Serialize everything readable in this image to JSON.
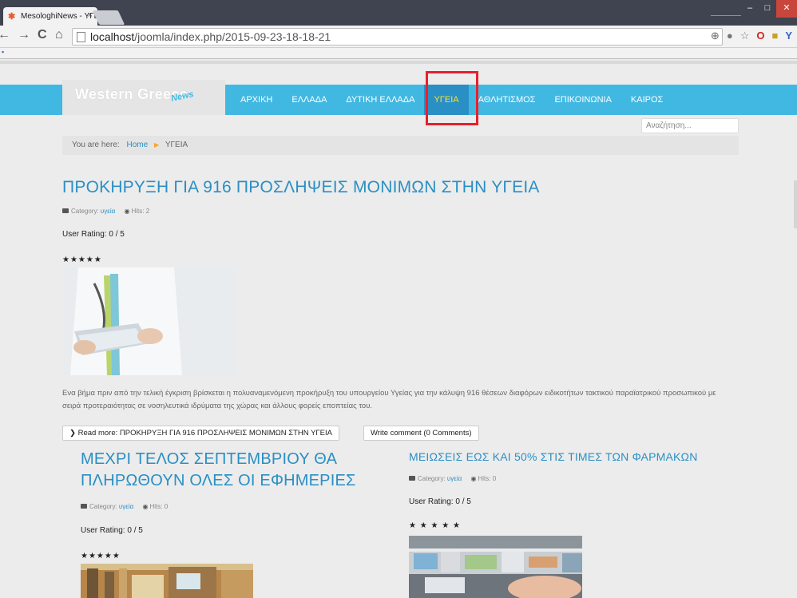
{
  "browser": {
    "tab_title": "MesologhiNews - ΥΓΕΙΑ",
    "tab_close": "×",
    "url_host": "localhost",
    "url_path": "/joomla/index.php/2015-09-23-18-18-21",
    "nav_back": "←",
    "nav_forward": "→",
    "nav_reload": "C",
    "nav_home": "⌂",
    "win_min": "–",
    "win_max": "□",
    "win_close": "✕"
  },
  "site": {
    "logo_main": "Western Greece",
    "logo_sub": "News",
    "menu": [
      "ΑΡΧΙΚΗ",
      "ΕΛΛΑΔΑ",
      "ΔΥΤΙΚΗ ΕΛΛΑΔΑ",
      "ΥΓΕΙΑ",
      "ΑΘΛΗΤΙΣΜΟΣ",
      "ΕΠΙΚΟΙΝΩΝΙΑ",
      "ΚΑΙΡΟΣ"
    ],
    "active_menu": "ΥΓΕΙΑ",
    "search_placeholder": "Αναζήτηση..."
  },
  "breadcrumb": {
    "prefix": "You are here:",
    "home": "Home",
    "current": "ΥΓΕΙΑ"
  },
  "articles": {
    "main": {
      "title": "ΠΡΟΚΗΡΥΞΗ ΓΙΑ 916 ΠΡΟΣΛΗΨΕΙΣ ΜΟΝΙΜΩΝ ΣΤΗΝ ΥΓΕΙΑ",
      "category_label": "Category:",
      "category": "υγεία",
      "hits": "Hits: 2",
      "rating": "User Rating:  0 / 5",
      "stars": "★★★★★",
      "intro": "Ενα βήμα πριν από την τελική έγκριση βρίσκεται η πολυαναμενόμενη προκήρυξη του υπουργείου Υγείας για την κάλυψη 916 θέσεων διαφόρων ειδικοτήτων τακτικού παραϊατρικού προσωπικού με σειρά προτεραιότητας σε νοσηλευτικά ιδρύματα της χώρας και άλλους φορείς εποπτείας του.",
      "read_more": "Read more: ΠΡΟΚΗΡΥΞΗ ΓΙΑ 916 ΠΡΟΣΛΗΨΕΙΣ ΜΟΝΙΜΩΝ ΣΤΗΝ ΥΓΕΙΑ",
      "write_comment": "Write comment (0 Comments)"
    },
    "left": {
      "title": "ΜΕΧΡΙ ΤΕΛΟΣ ΣΕΠΤΕΜΒΡΙΟΥ ΘΑ ΠΛΗΡΩΘΟΥΝ ΟΛΕΣ ΟΙ ΕΦΗΜΕΡΙΕΣ",
      "category_label": "Category:",
      "category": "υγεία",
      "hits": "Hits: 0",
      "rating": "User Rating:  0 / 5",
      "stars": "★★★★★"
    },
    "right": {
      "title": "ΜΕΙΩΣΕΙΣ ΕΩΣ ΚΑΙ 50% ΣΤΙΣ ΤΙΜΕΣ ΤΩΝ ΦΑΡΜΑΚΩΝ",
      "category_label": "Category:",
      "category": "υγεία",
      "hits": "Hits: 0",
      "rating": "User Rating:  0 / 5",
      "stars": "★ ★ ★ ★ ★"
    }
  },
  "colors": {
    "nav": "#41b8e2",
    "active": "#2a8fc4",
    "highlight": "#e8202a"
  }
}
